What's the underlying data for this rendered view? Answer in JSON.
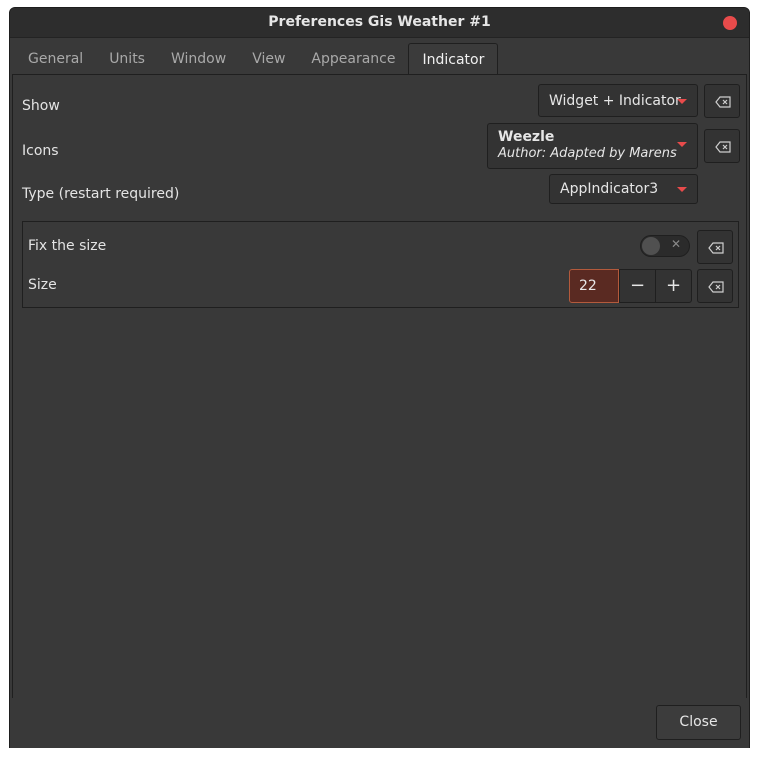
{
  "window": {
    "title": "Preferences Gis Weather #1"
  },
  "tabs": [
    {
      "label": "General"
    },
    {
      "label": "Units"
    },
    {
      "label": "Window"
    },
    {
      "label": "View"
    },
    {
      "label": "Appearance"
    },
    {
      "label": "Indicator",
      "active": true
    }
  ],
  "show": {
    "label": "Show",
    "value": "Widget + Indicator"
  },
  "icons": {
    "label": "Icons",
    "value_title": "Weezle",
    "value_author": "Author: Adapted by Marens"
  },
  "type": {
    "label": "Type (restart required)",
    "value": "AppIndicator3"
  },
  "fix_size": {
    "label": "Fix the size",
    "toggle_on": false,
    "toggle_mark": "✕"
  },
  "size": {
    "label": "Size",
    "value": "22",
    "minus": "−",
    "plus": "+"
  },
  "footer": {
    "close_label": "Close"
  },
  "colors": {
    "accent": "#e84b4b",
    "background": "#393939",
    "titlebar": "#2d2d2d"
  }
}
